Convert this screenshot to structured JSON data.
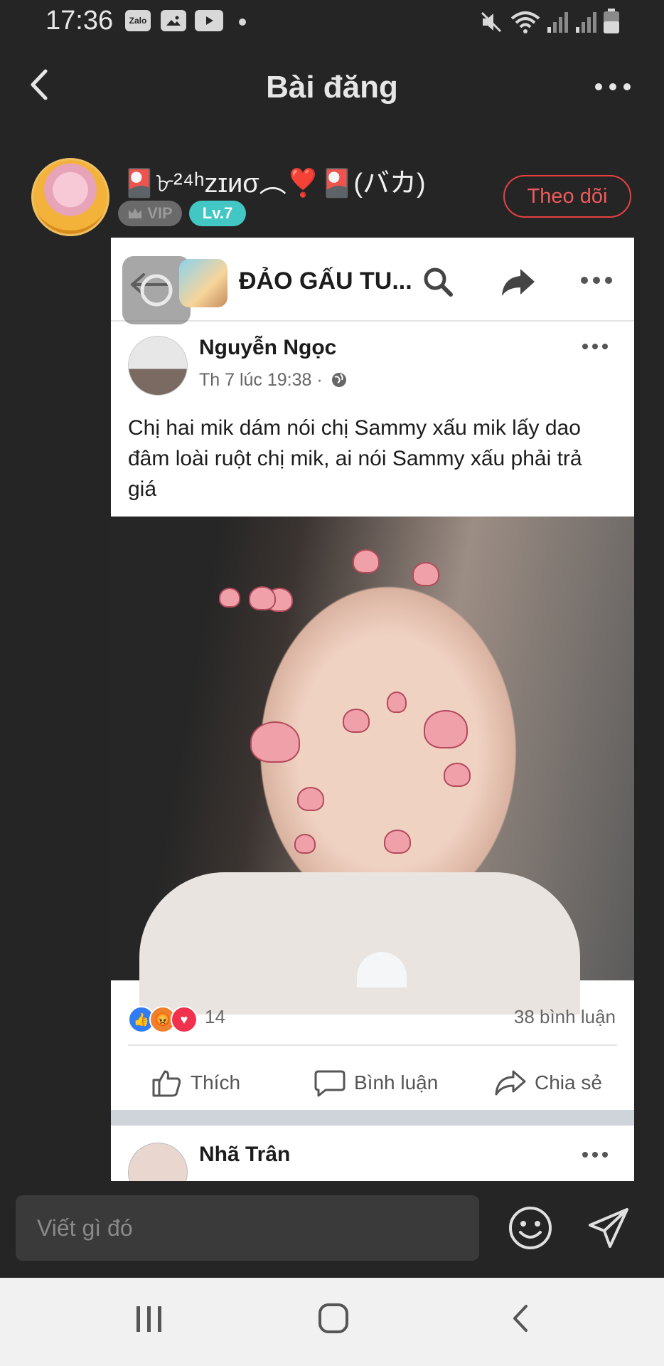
{
  "status_bar": {
    "time": "17:36",
    "notification_icons": [
      "zalo-icon",
      "gallery-icon",
      "youtube-icon",
      "dot-icon"
    ],
    "zalo_label": "Zalo",
    "system_icons": [
      "mute-icon",
      "wifi-icon",
      "signal-icon",
      "signal-icon",
      "battery-icon"
    ]
  },
  "header": {
    "title": "Bài đăng"
  },
  "author": {
    "name": "🎴৮²⁴ʰzɪиσ︵❣️🎴(バカ)",
    "vip_label": "VIP",
    "level_label": "Lv.7",
    "follow_label": "Theo dõi"
  },
  "embedded_post": {
    "page_title": "ĐẢO GẤU TU...",
    "poster_name": "Nguyễn Ngọc",
    "meta": "Th 7 lúc 19:38 ·",
    "text": "Chị hai mik dám nói chị Sammy xấu mik lấy dao đâm loài ruột chị mik, ai nói Sammy xấu phải trả giá",
    "reaction_count": "14",
    "comment_count": "38 bình luận",
    "actions": {
      "like": "Thích",
      "comment": "Bình luận",
      "share": "Chia sẻ"
    },
    "next_poster_name": "Nhã Trân"
  },
  "composer": {
    "placeholder": "Viết gì đó"
  }
}
